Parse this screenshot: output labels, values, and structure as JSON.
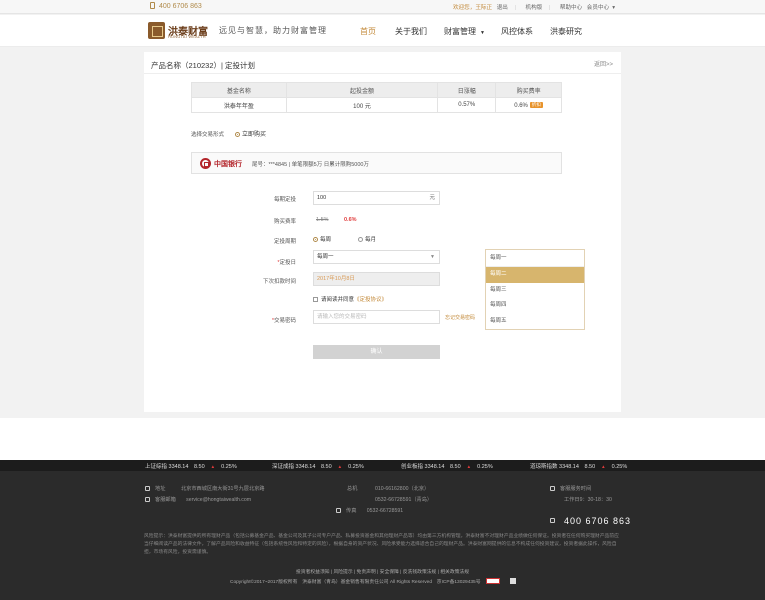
{
  "topbar": {
    "phone": "400 6706 863",
    "welcome": "欢迎您，王际正",
    "logout": "退出",
    "org": "机构版",
    "help": "帮助中心",
    "member": "会员中心"
  },
  "header": {
    "logo_cn": "洪泰财富",
    "logo_en": "HONGTAI WEALTH",
    "slogan": "远见与智慧，助力财富管理",
    "nav": [
      "首页",
      "关于我们",
      "财富管理",
      "风控体系",
      "洪泰研究"
    ]
  },
  "card": {
    "title": "产品名称（210232）| 定投计划",
    "back": "返回>>",
    "table": {
      "headers": [
        "基金名称",
        "起投金额",
        "日涨幅",
        "购买费率"
      ],
      "row": [
        "洪泰年年盈",
        "100 元",
        "0.57%",
        "0.6%"
      ],
      "badge": "折扣"
    },
    "trade_label": "选择交易形式",
    "trade_option": "立即购买",
    "bank": {
      "name": "中国银行",
      "info": "尾号：***4845 | 单笔限额5万 日累计限购5000万"
    },
    "form": {
      "amount_label": "每期定投",
      "amount_value": "100",
      "amount_unit": "元",
      "rate_label": "购买费率",
      "rate_old": "1.5%",
      "rate_new": "0.6%",
      "period_label": "定投周期",
      "period_week": "每周",
      "period_month": "每月",
      "day_label": "定投日",
      "day_value": "每周一",
      "next_label": "下次扣款时间",
      "next_value": "2017年10月8日",
      "agree_text": "请阅读并同意",
      "agree_link": "《定投协议》",
      "pwd_label": "交易密码",
      "pwd_placeholder": "请输入您的交易密码",
      "forgot": "忘记交易密码",
      "submit": "确认"
    },
    "dropdown": [
      "每周一",
      "每周二",
      "每周三",
      "每周四",
      "每周五"
    ]
  },
  "footer": {
    "ticker": [
      {
        "name": "上证综指",
        "value": "3348.14",
        "change": "8.50",
        "pct": "0.25%"
      },
      {
        "name": "深证成指",
        "value": "3348.14",
        "change": "8.50",
        "pct": "0.25%"
      },
      {
        "name": "创业板指",
        "value": "3348.14",
        "change": "8.50",
        "pct": "0.25%"
      },
      {
        "name": "道琼斯指数",
        "value": "3348.14",
        "change": "8.50",
        "pct": "0.25%"
      }
    ],
    "address_label": "地址",
    "address": "北京市西城区南大街31号九层北京路",
    "email_label": "客服邮箱",
    "email": "service@hongtaiwealth.com",
    "phone_label": "总机",
    "phone_1": "010-66162800（北京）",
    "phone_2": "0532-66728591（青岛）",
    "fax_label": "传真",
    "fax": "0532-66728591",
    "service_title": "客服服务时间",
    "service_time": "工作日9：30-18：30",
    "hotline": "400 6706 863",
    "note": "风险提示：洪泰财富提供的所有理财产品（包括公募基金产品、基金公司及其子公司专户产品、私募投资基金和其他理财产品等）均由第三方机构管理，洪泰财富不对理财产品业绩做任何保证。投资者在任何购买理财产品前应当仔细阅读产品的法律文件，了解产品风险和收益特征（包括系统性风险和特定的风险），根据自身的资产状况、风险承受能力选择适合自己的理财产品。洪泰财富网提供的信息不构成任何投资建议，投资者据此操作，风险自担，市场有风险，投资需谨慎。",
    "links": "投资者权益须知 | 风险提示 | 免责声明 | 安全保障 | 反洗钱政策法规 | 相关政策法规",
    "copyright": "Copyright©2017~2017版权所有　洪泰财富（青岛）基金销售有限责任公司 All Rights Reserved　京ICP备13029435号"
  }
}
